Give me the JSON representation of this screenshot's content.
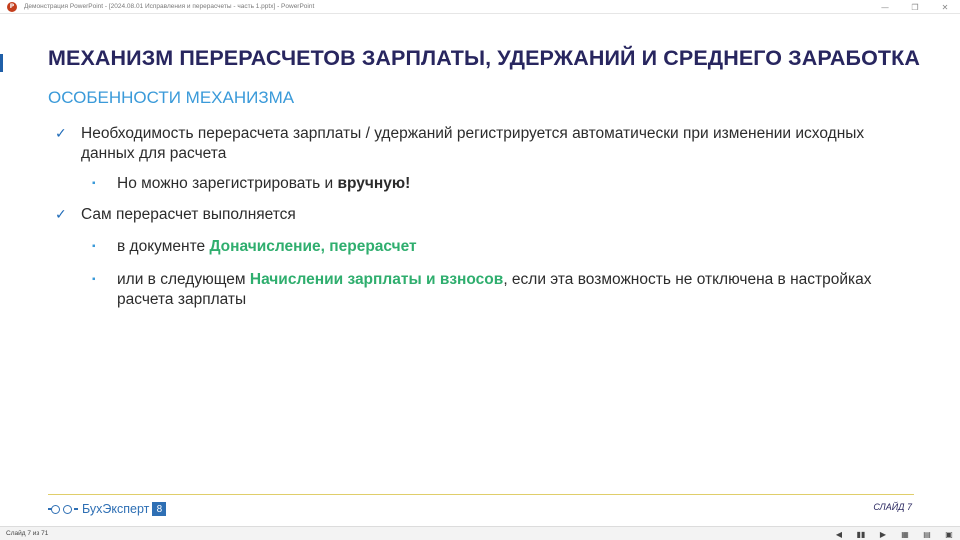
{
  "window": {
    "app_icon_letter": "P",
    "title": "Демонстрация PowerPoint - [2024.08.01 Исправления и перерасчеты - часть 1.pptx] - PowerPoint",
    "controls": [
      "—",
      "❐",
      "✕"
    ]
  },
  "slide": {
    "title": "МЕХАНИЗМ ПЕРЕРАСЧЕТОВ ЗАРПЛАТЫ, УДЕРЖАНИЙ И СРЕДНЕГО ЗАРАБОТКА",
    "subtitle": "ОСОБЕННОСТИ МЕХАНИЗМА",
    "items": [
      {
        "marker": "✓",
        "text": "Необходимость перерасчета зарплаты / удержаний регистрируется автоматически при изменении исходных данных для расчета"
      },
      {
        "marker": "▪",
        "prefix": "Но можно зарегистрировать и ",
        "bold": "вручную!"
      },
      {
        "marker": "✓",
        "text": "Сам перерасчет выполняется"
      },
      {
        "marker": "▪",
        "prefix": "в документе ",
        "highlight": "Доначисление, перерасчет"
      },
      {
        "marker": "▪",
        "prefix": "или в следующем ",
        "highlight": "Начислении зарплаты и взносов",
        "suffix": ", если эта возможность не отключена в настройках расчета зарплаты"
      }
    ],
    "footer": {
      "brand": "БухЭксперт",
      "brand_badge": "8",
      "slide_label": "СЛАЙД 7"
    }
  },
  "statusbar": {
    "slide_counter": "Слайд 7 из 71",
    "icons": [
      "◀",
      "▮▮",
      "▶",
      "▦",
      "▤",
      "▣"
    ]
  },
  "colors": {
    "title": "#28265f",
    "subtitle": "#3a9ad9",
    "highlight": "#2fae6e",
    "brand": "#2e6fb4",
    "footer_line": "#e0ce6a"
  }
}
